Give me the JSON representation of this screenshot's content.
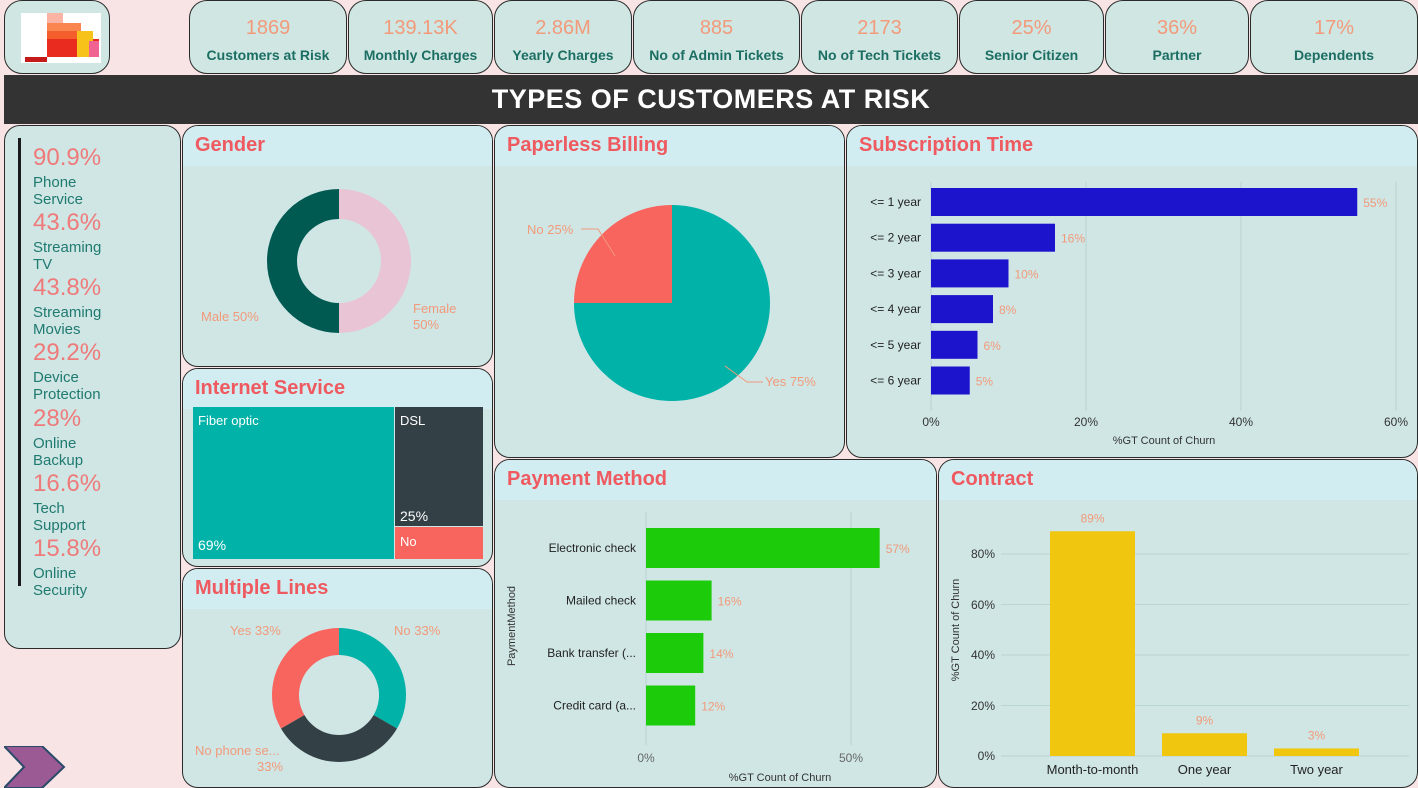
{
  "kpis": [
    {
      "value": "1869",
      "label": "Customers at Risk"
    },
    {
      "value": "139.13K",
      "label": "Monthly Charges"
    },
    {
      "value": "2.86M",
      "label": "Yearly Charges"
    },
    {
      "value": "885",
      "label": "No of Admin Tickets"
    },
    {
      "value": "2173",
      "label": "No of Tech Tickets"
    },
    {
      "value": "25%",
      "label": "Senior Citizen"
    },
    {
      "value": "36%",
      "label": "Partner"
    },
    {
      "value": "17%",
      "label": "Dependents"
    }
  ],
  "banner_title": "TYPES OF CUSTOMERS AT RISK",
  "services": [
    {
      "pct": "90.9%",
      "name": "Phone Service"
    },
    {
      "pct": "43.6%",
      "name": "Streaming TV"
    },
    {
      "pct": "43.8%",
      "name": "Streaming Movies"
    },
    {
      "pct": "29.2%",
      "name": "Device Protection"
    },
    {
      "pct": "28%",
      "name": "Online Backup"
    },
    {
      "pct": "16.6%",
      "name": "Tech Support"
    },
    {
      "pct": "15.8%",
      "name": "Online Security"
    }
  ],
  "colors": {
    "teal": "#00b2a7",
    "dark": "#334046",
    "coral": "#f8645e",
    "pink": "#e8c4d4",
    "darkgreen": "#005a52",
    "blue": "#1c13cc",
    "green": "#1ccc0a",
    "gold": "#f0c60e",
    "label": "#f29a7a",
    "title": "#ee5a5f"
  },
  "gender": {
    "title": "Gender",
    "labels": [
      {
        "text": "Male 50%"
      },
      {
        "text": "Female"
      },
      {
        "text": "50%"
      }
    ]
  },
  "internet": {
    "title": "Internet Service",
    "fiber_label": "Fiber optic",
    "fiber_value": "69%",
    "dsl_label": "DSL",
    "dsl_value": "25%",
    "no_label": "No"
  },
  "multiple_lines": {
    "title": "Multiple Lines",
    "labels": [
      "Yes 33%",
      "No 33%",
      "No phone se...",
      "33%"
    ]
  },
  "paperless": {
    "title": "Paperless Billing",
    "labels": [
      "No 25%",
      "Yes 75%"
    ]
  },
  "subscription": {
    "title": "Subscription Time",
    "xlabel": "%GT Count of Churn",
    "ticks": [
      "0%",
      "20%",
      "40%",
      "60%"
    ]
  },
  "payment": {
    "title": "Payment Method",
    "xlabel": "%GT Count of Churn",
    "ylabel": "PaymentMethod",
    "ticks": [
      "0%",
      "50%"
    ]
  },
  "contract": {
    "title": "Contract",
    "ylabel": "%GT Count of Churn",
    "ticks": [
      "0%",
      "20%",
      "40%",
      "60%",
      "80%"
    ]
  },
  "chart_data": [
    {
      "type": "pie",
      "title": "Gender",
      "categories": [
        "Male",
        "Female"
      ],
      "values": [
        50,
        50
      ]
    },
    {
      "type": "pie",
      "title": "Paperless Billing",
      "categories": [
        "No",
        "Yes"
      ],
      "values": [
        25,
        75
      ]
    },
    {
      "type": "pie",
      "title": "Multiple Lines",
      "categories": [
        "Yes",
        "No",
        "No phone se..."
      ],
      "values": [
        33,
        33,
        33
      ]
    },
    {
      "type": "bar",
      "title": "Subscription Time",
      "orientation": "horizontal",
      "categories": [
        "<= 1 year",
        "<= 2 year",
        "<= 3 year",
        "<= 4 year",
        "<= 5 year",
        "<= 6 year"
      ],
      "values": [
        55,
        16,
        10,
        8,
        6,
        5
      ],
      "value_labels": [
        "55%",
        "16%",
        "10%",
        "8%",
        "6%",
        "5%"
      ],
      "xlabel": "%GT Count of Churn",
      "xlim": [
        0,
        60
      ]
    },
    {
      "type": "bar",
      "title": "Payment Method",
      "orientation": "horizontal",
      "categories": [
        "Electronic check",
        "Mailed check",
        "Bank transfer (...",
        "Credit card (a..."
      ],
      "values": [
        57,
        16,
        14,
        12
      ],
      "value_labels": [
        "57%",
        "16%",
        "14%",
        "12%"
      ],
      "xlabel": "%GT Count of Churn",
      "ylabel": "PaymentMethod",
      "xlim": [
        0,
        80
      ]
    },
    {
      "type": "bar",
      "title": "Contract",
      "categories": [
        "Month-to-month",
        "One year",
        "Two year"
      ],
      "values": [
        89,
        9,
        3
      ],
      "value_labels": [
        "89%",
        "9%",
        "3%"
      ],
      "ylabel": "%GT Count of Churn",
      "ylim": [
        0,
        80
      ]
    }
  ]
}
